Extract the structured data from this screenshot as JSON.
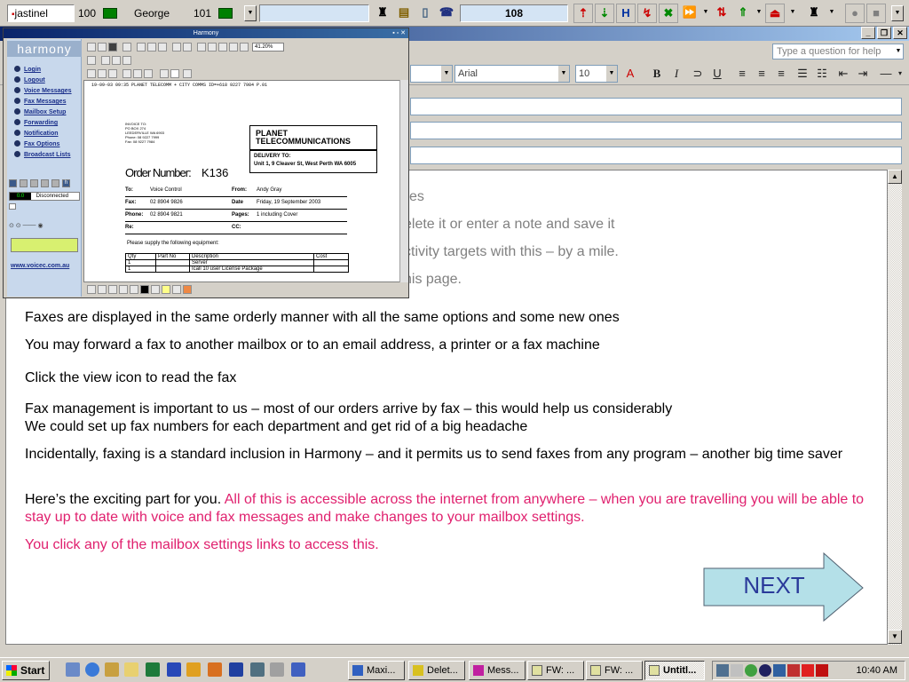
{
  "phone_toolbar": {
    "line1_name": "jastinel",
    "line1_ext": "100",
    "line2_name": "George",
    "line2_ext": "101",
    "counter": "108",
    "colors": {
      "status_light": "#008000",
      "counter_bg": "#d4e4f4"
    }
  },
  "office": {
    "help_placeholder": "Type a question for help",
    "font_name": "Arial",
    "font_size": "10"
  },
  "harmony": {
    "title": "Harmony",
    "logo": "harmony",
    "nav": [
      {
        "label": "Login",
        "icon": "login-icon"
      },
      {
        "label": "Logout",
        "icon": "logout-icon"
      },
      {
        "label": "Voice Messages",
        "icon": "voice-icon"
      },
      {
        "label": "Fax Messages",
        "icon": "fax-icon"
      },
      {
        "label": "Mailbox Setup",
        "icon": "mailbox-icon"
      },
      {
        "label": "Forwarding",
        "icon": "forward-icon"
      },
      {
        "label": "Notification",
        "icon": "notification-icon"
      },
      {
        "label": "Fax Options",
        "icon": "fax-options-icon"
      },
      {
        "label": "Broadcast Lists",
        "icon": "broadcast-icon"
      }
    ],
    "counter": "0.0",
    "connection_status": "Disconnected",
    "website": "www.voicec.com.au",
    "zoom": "41.20%",
    "fax": {
      "header_line": "19-09-03  09:35  PLANET TELECOMM + CITY COMMS    ID=+618 9227 7984        P.01",
      "invoice_lines": [
        "INVOICE TO:",
        "PO BOX 274",
        "LEEDERVILLE WA 6903",
        "Phone:  08 9227 7999",
        "Fax:    08 9227 7984"
      ],
      "company_line1": "PLANET",
      "company_line2": "TELECOMMUNICATIONS",
      "delivery_label": "DELIVERY TO:",
      "delivery_address": "Unit 1, 9 Cleaver St, West Perth WA 6005",
      "order_label": "Order Number:",
      "order_number": "K136",
      "to_label": "To:",
      "to_value": "Voice Control",
      "from_label": "From:",
      "from_value": "Andy Gray",
      "fax_label": "Fax:",
      "fax_value": "02 8904 9826",
      "date_label": "Date",
      "date_value": "Friday, 19 September 2003",
      "phone_label": "Phone:",
      "phone_value": "02 8904 9821",
      "pages_label": "Pages:",
      "pages_value": "1 including Cover",
      "re_label": "Re:",
      "cc_label": "CC:",
      "supply_text": "Please supply the following equipment:",
      "table_headers": [
        "Qty",
        "Part No",
        "Description",
        "Cost"
      ],
      "table_rows": [
        [
          "1",
          "",
          "Server",
          ""
        ],
        [
          "1",
          "",
          "Icall 10 user License Package",
          ""
        ]
      ]
    }
  },
  "body": {
    "faded_lines": [
      "es",
      "elete it or enter a note and save it",
      "ctivity targets with this – by a mile.",
      "his page."
    ],
    "p1": "Faxes are displayed in the same orderly manner with all the same options and some new ones",
    "p2": "You may forward a fax to another mailbox or to an email address, a printer or a fax machine",
    "p3": "Click the view icon to read the fax",
    "p4a": "Fax management is important to us – most of our orders arrive by fax – this would help us considerably",
    "p4b": "We could set up fax numbers for each department and get rid of a big headache",
    "p5": "Incidentally, faxing is a standard inclusion in Harmony – and it permits us to send faxes from any program – another big time saver",
    "p6_black": "Here’s the exciting part for you. ",
    "p6_pink": "All of this is accessible across the internet from anywhere – when you are travelling you will be able to stay up to date with voice and fax messages and make changes to your mailbox settings.",
    "p7": "You click any of the mailbox settings links to access this.",
    "next_label": "NEXT",
    "colors": {
      "highlight": "#e0206e",
      "next_fill": "#b4e0e8",
      "next_text": "#2a3a9a"
    }
  },
  "taskbar": {
    "start_label": "Start",
    "tasks": [
      "Maxi...",
      "Delet...",
      "Mess...",
      "FW: ...",
      "FW: ...",
      "Untitl..."
    ],
    "clock": "10:40 AM"
  }
}
